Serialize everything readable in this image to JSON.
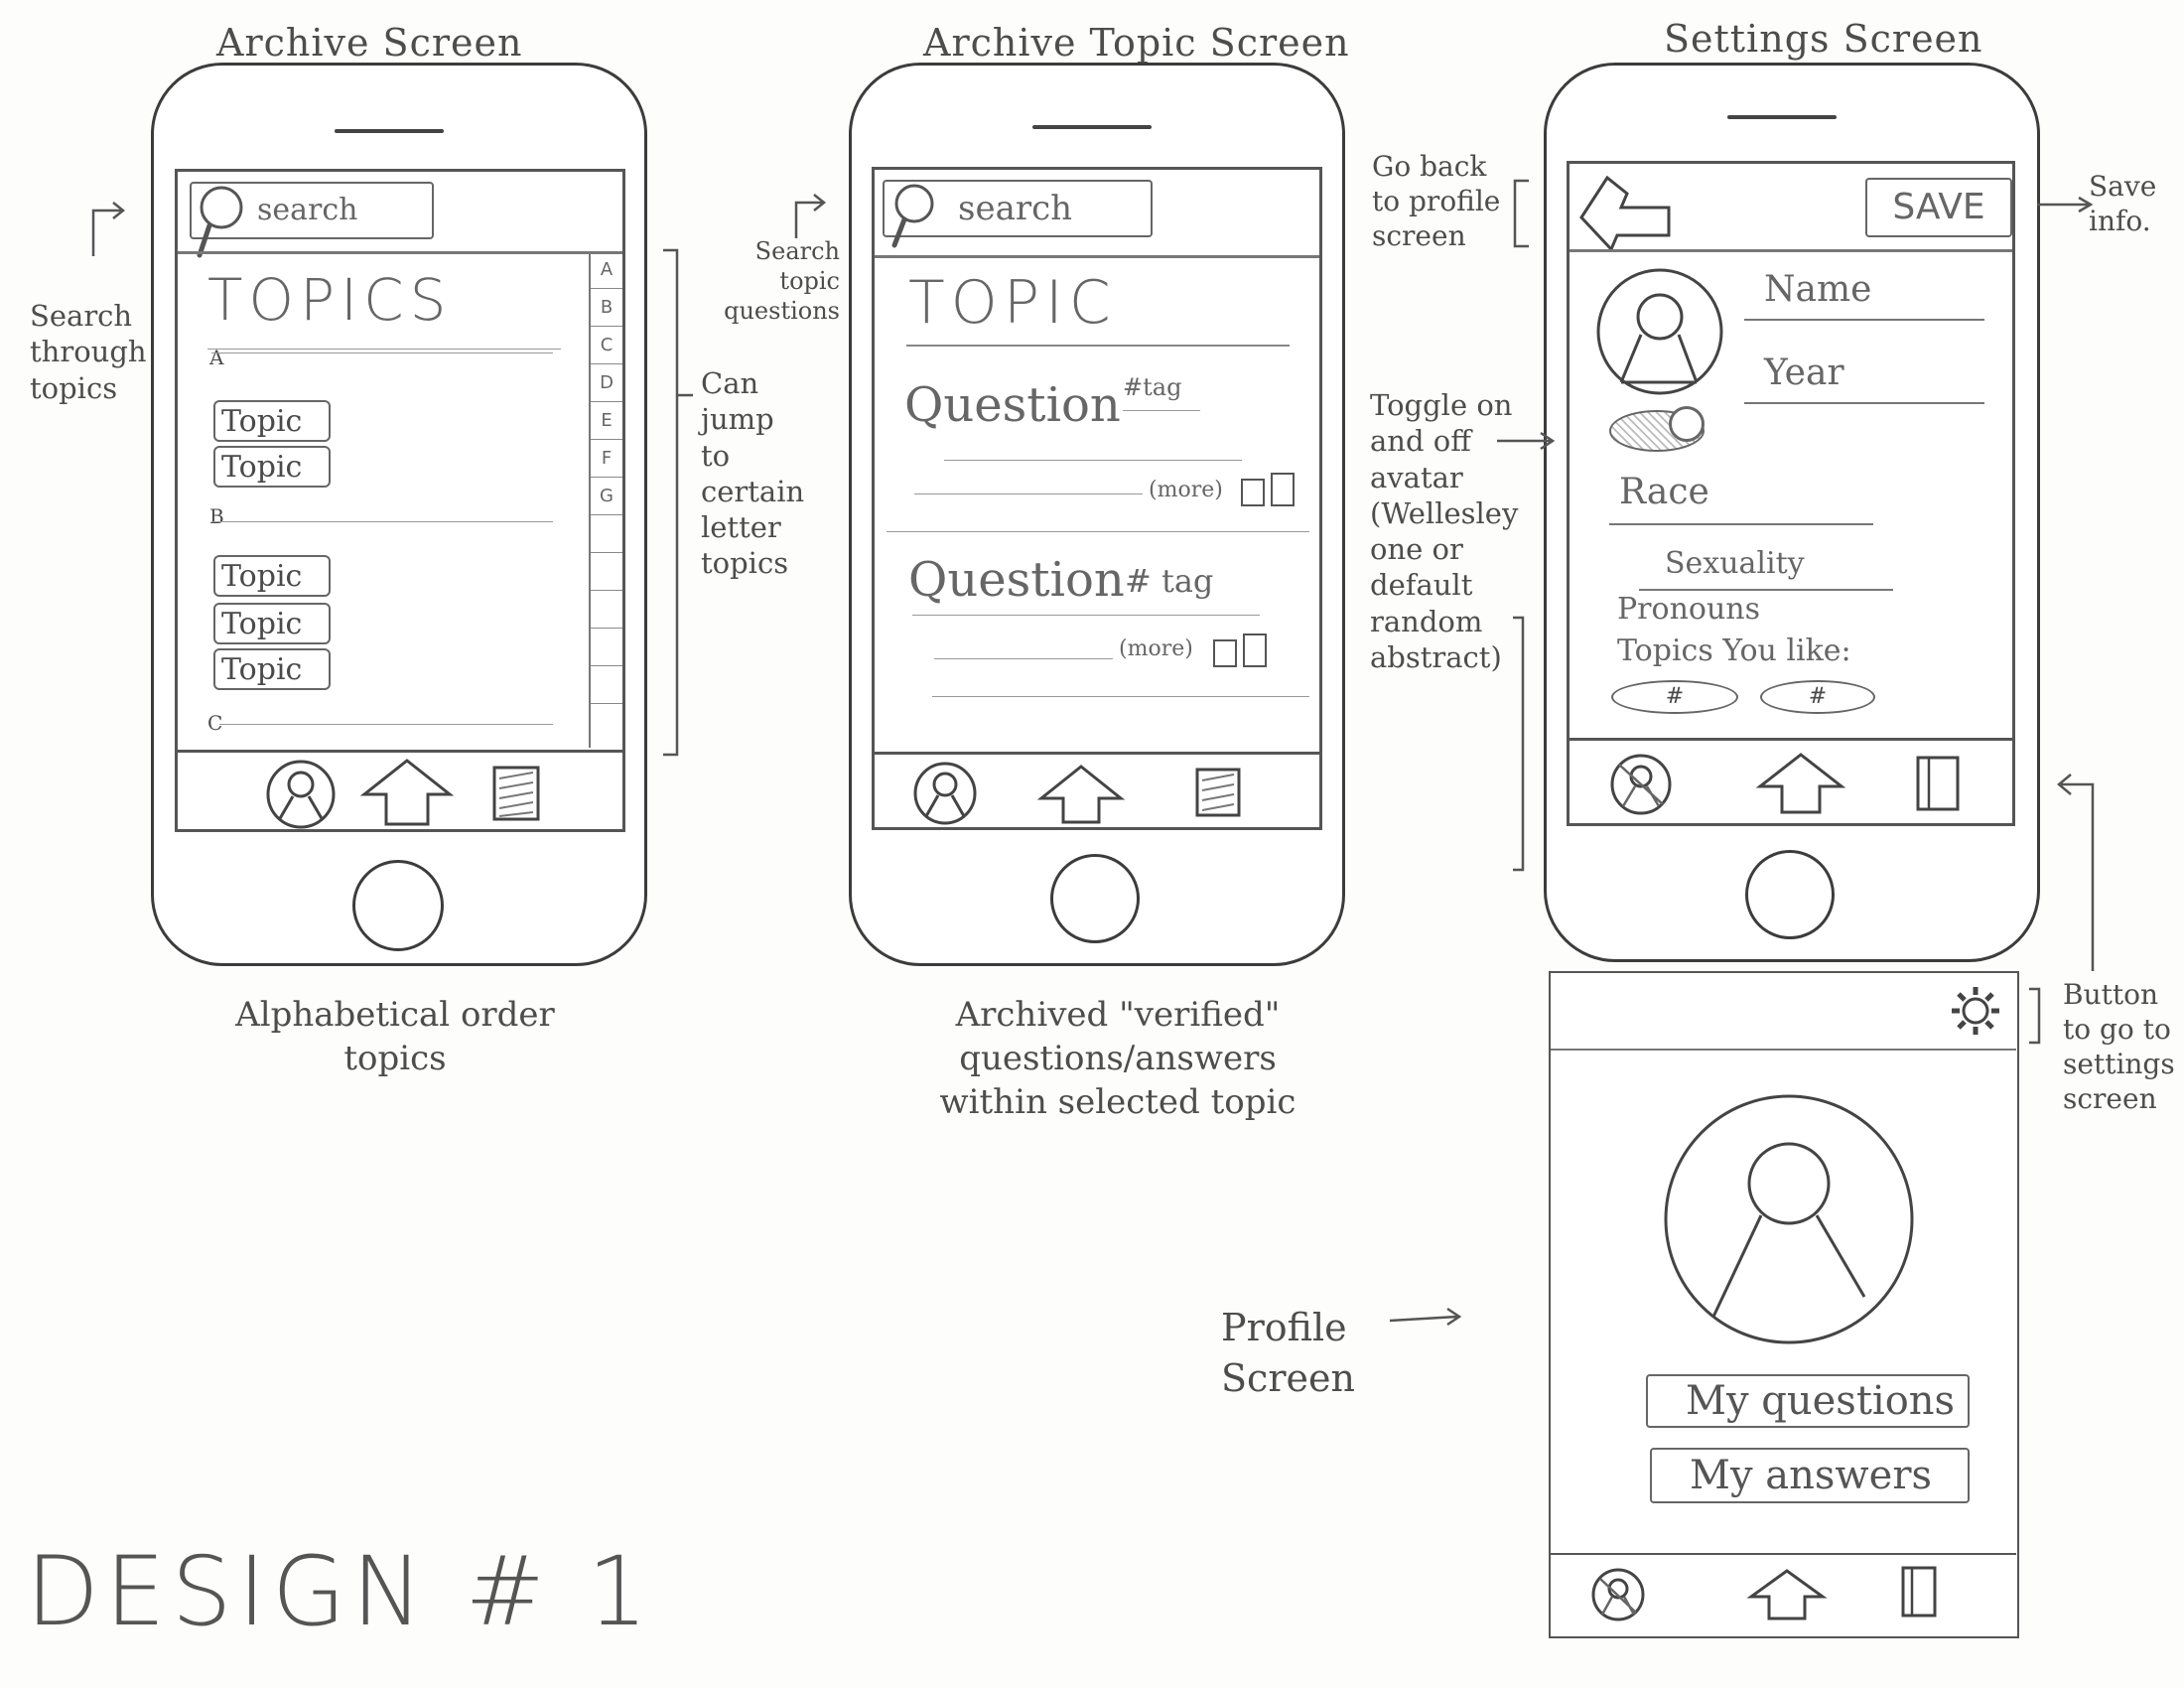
{
  "archive_screen": {
    "title": "Archive Screen",
    "search_placeholder": "search",
    "heading": "TOPICS",
    "section_a": "A",
    "section_b": "B",
    "section_c": "C",
    "topics_a": [
      "Topic",
      "Topic"
    ],
    "topics_b": [
      "Topic",
      "Topic",
      "Topic"
    ],
    "alphabet": [
      "A",
      "B",
      "C",
      "D",
      "E",
      "F",
      "G",
      "",
      "",
      "",
      "",
      ""
    ],
    "caption": "Alphabetical order topics",
    "note_search": "Search through topics",
    "note_jump": "Can jump to certain letter topics"
  },
  "archive_topic_screen": {
    "title": "Archive Topic Screen",
    "search_placeholder": "search",
    "heading": "TOPIC",
    "questions": [
      {
        "text": "Question",
        "tag": "#tag",
        "more": "(more)"
      },
      {
        "text": "Question",
        "tag": "# tag",
        "more": "(more)"
      }
    ],
    "caption": "Archived \"verified\" questions/answers within selected topic",
    "note_search": "Search topic questions"
  },
  "settings_screen": {
    "title": "Settings Screen",
    "save_label": "SAVE",
    "fields": [
      "Name",
      "Year",
      "Race",
      "Sexuality",
      "Pronouns"
    ],
    "topics_you_like_label": "Topics You like:",
    "topic_tags": [
      "#",
      "#"
    ],
    "note_back": "Go back to profile screen",
    "note_save": "Save info.",
    "note_toggle": "Toggle on and off avatar (Wellesley one or default random abstract)"
  },
  "profile_screen": {
    "title": "Profile Screen",
    "my_questions_label": "My questions",
    "my_answers_label": "My answers",
    "note_settings_button": "Button to go to settings screen"
  },
  "design_label": "DESIGN # 1"
}
